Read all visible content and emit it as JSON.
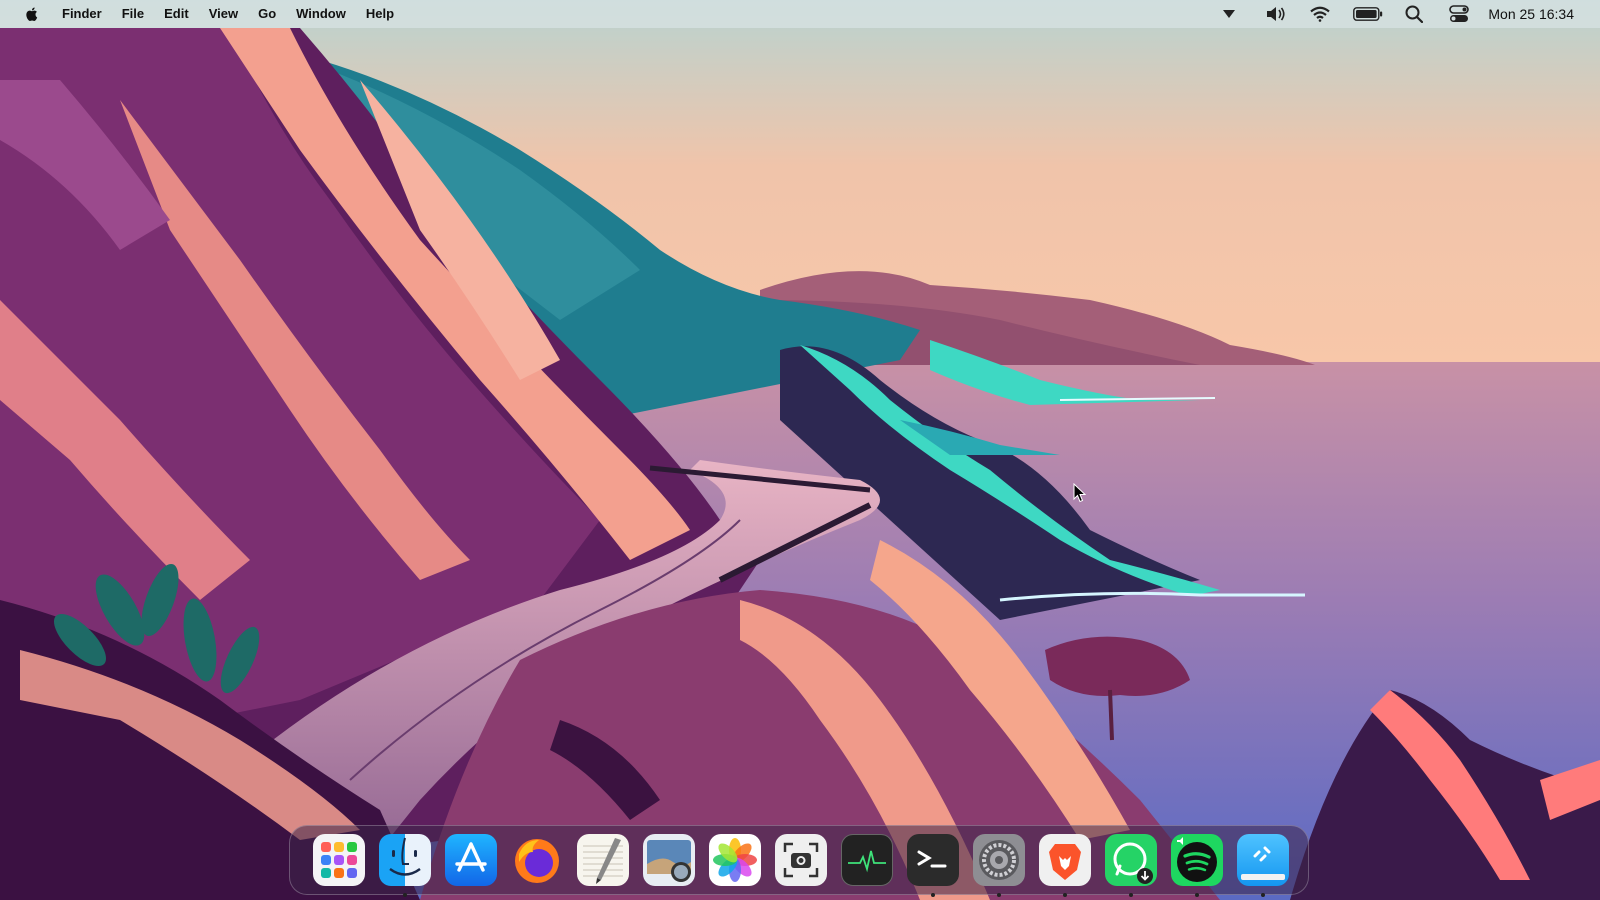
{
  "menubar": {
    "apple_icon": "apple-logo-icon",
    "items": [
      {
        "label": "Finder"
      },
      {
        "label": "File"
      },
      {
        "label": "Edit"
      },
      {
        "label": "View"
      },
      {
        "label": "Go"
      },
      {
        "label": "Window"
      },
      {
        "label": "Help"
      }
    ],
    "status_icons": [
      "dropdown-arrow-icon",
      "volume-icon",
      "wifi-icon",
      "battery-icon",
      "spotlight-search-icon",
      "control-center-icon"
    ],
    "clock": "Mon 25 16:34"
  },
  "dock": {
    "apps": [
      {
        "name": "Launchpad",
        "running": false
      },
      {
        "name": "Finder",
        "running": true
      },
      {
        "name": "App Store",
        "running": false
      },
      {
        "name": "Firefox",
        "running": false
      },
      {
        "name": "TextEdit",
        "running": false
      },
      {
        "name": "Preview",
        "running": false
      },
      {
        "name": "Photos",
        "running": false
      },
      {
        "name": "Screenshot",
        "running": false
      },
      {
        "name": "Activity Monitor",
        "running": false
      },
      {
        "name": "Terminal",
        "running": true
      },
      {
        "name": "System Settings",
        "running": true
      },
      {
        "name": "Brave Browser",
        "running": true
      },
      {
        "name": "WhatsApp",
        "running": true
      },
      {
        "name": "Spotify",
        "running": true
      },
      {
        "name": "Xcode Simulator",
        "running": true
      }
    ]
  },
  "colors": {
    "menubar": "#d6e0e0",
    "sky_top": "#b9d3d0",
    "sky_bottom": "#f6c4a8",
    "sea": "#8d7ab8",
    "cliff_pink": "#f3a08f",
    "cliff_purple": "#6a2a6b",
    "teal": "#3cd6c0"
  }
}
